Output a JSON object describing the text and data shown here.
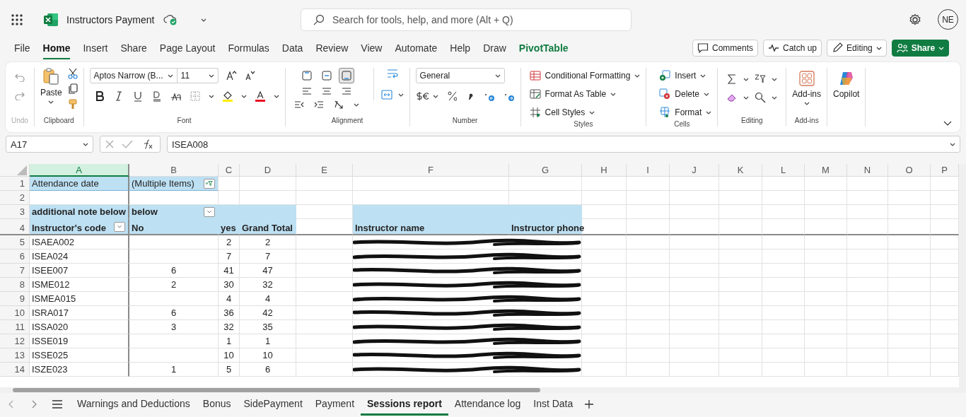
{
  "app": {
    "file_name": "Instructors Payment",
    "search_placeholder": "Search for tools, help, and more (Alt + Q)",
    "account_initials": "NE"
  },
  "menu_tabs": [
    {
      "label": "File",
      "selected": false,
      "kind": "plain"
    },
    {
      "label": "Home",
      "selected": true,
      "kind": "plain"
    },
    {
      "label": "Insert",
      "selected": false,
      "kind": "plain"
    },
    {
      "label": "Share",
      "selected": false,
      "kind": "plain"
    },
    {
      "label": "Page Layout",
      "selected": false,
      "kind": "plain"
    },
    {
      "label": "Formulas",
      "selected": false,
      "kind": "plain"
    },
    {
      "label": "Data",
      "selected": false,
      "kind": "plain"
    },
    {
      "label": "Review",
      "selected": false,
      "kind": "plain"
    },
    {
      "label": "View",
      "selected": false,
      "kind": "plain"
    },
    {
      "label": "Automate",
      "selected": false,
      "kind": "plain"
    },
    {
      "label": "Help",
      "selected": false,
      "kind": "plain"
    },
    {
      "label": "Draw",
      "selected": false,
      "kind": "plain"
    },
    {
      "label": "PivotTable",
      "selected": false,
      "kind": "contextual"
    }
  ],
  "actions": [
    {
      "label": "Comments",
      "kind": "comments"
    },
    {
      "label": "Catch up",
      "kind": "catchup"
    },
    {
      "label": "Editing",
      "kind": "editing"
    },
    {
      "label": "Share",
      "kind": "share"
    }
  ],
  "ribbon": {
    "undo": {
      "label": "Undo",
      "disabled": true
    },
    "clipboard": {
      "label": "Clipboard",
      "paste": "Paste"
    },
    "font": {
      "label": "Font",
      "font_name": "Aptos Narrow (B...",
      "font_size": "11"
    },
    "alignment": {
      "label": "Alignment",
      "vertical_align": [
        {
          "selected": false
        },
        {
          "selected": false
        },
        {
          "selected": true
        }
      ]
    },
    "number": {
      "label": "Number",
      "format": "General"
    },
    "styles": {
      "label": "Styles",
      "commands": [
        "Conditional Formatting",
        "Format As Table",
        "Cell Styles"
      ]
    },
    "cells": {
      "label": "Cells",
      "commands": [
        "Insert",
        "Delete",
        "Format"
      ]
    },
    "editing": {
      "label": "Editing"
    },
    "addins": {
      "label": "Add-ins",
      "button": "Add-ins"
    },
    "copilot": {
      "button": "Copilot"
    }
  },
  "formula_bar": {
    "name_box": "A17",
    "formula": "ISEA008"
  },
  "sheet": {
    "columns": [
      {
        "label": "A",
        "selected": true
      },
      {
        "label": "B",
        "selected": false
      },
      {
        "label": "C",
        "selected": false
      },
      {
        "label": "D",
        "selected": false
      },
      {
        "label": "E",
        "selected": false
      },
      {
        "label": "F",
        "selected": false
      },
      {
        "label": "G",
        "selected": false
      },
      {
        "label": "H",
        "selected": false
      },
      {
        "label": "I",
        "selected": false
      },
      {
        "label": "J",
        "selected": false
      },
      {
        "label": "K",
        "selected": false
      },
      {
        "label": "L",
        "selected": false
      },
      {
        "label": "M",
        "selected": false
      },
      {
        "label": "N",
        "selected": false
      },
      {
        "label": "O",
        "selected": false
      },
      {
        "label": "P",
        "selected": false
      }
    ],
    "rows": [
      {
        "number": "1",
        "redacted": false,
        "cells": [
          {
            "text": "Attendance date",
            "kind": "field"
          },
          {
            "text": "(Multiple Items)",
            "kind": "field",
            "filter_applied": true
          }
        ]
      },
      {
        "number": "2",
        "redacted": false
      },
      {
        "number": "3",
        "redacted": false,
        "cells": [
          {
            "text": "additional note below",
            "kind": "header"
          },
          {
            "text": "below",
            "kind": "header",
            "filter_applied": false
          },
          {
            "text": "",
            "kind": "header"
          },
          {
            "text": "",
            "kind": "header"
          },
          {
            "text": ""
          },
          {
            "text": "",
            "kind": "header"
          },
          {
            "text": "",
            "kind": "header"
          }
        ]
      },
      {
        "number": "4",
        "redacted": false,
        "cells": [
          {
            "text": "Instructor's code",
            "kind": "header",
            "filter_applied": false
          },
          {
            "text": "No",
            "kind": "header"
          },
          {
            "text": "yes",
            "kind": "header"
          },
          {
            "text": "Grand Total",
            "kind": "header"
          },
          {
            "text": ""
          },
          {
            "text": "Instructor name",
            "kind": "header"
          },
          {
            "text": "Instructor phone",
            "kind": "header"
          }
        ]
      },
      {
        "number": "5",
        "redacted": true,
        "cells": [
          {
            "text": "ISAEA002"
          },
          {
            "text": "",
            "kind": "number"
          },
          {
            "text": "2",
            "kind": "number"
          },
          {
            "text": "2",
            "kind": "number"
          }
        ]
      },
      {
        "number": "6",
        "redacted": true,
        "cells": [
          {
            "text": "ISEA024"
          },
          {
            "text": "",
            "kind": "number"
          },
          {
            "text": "7",
            "kind": "number"
          },
          {
            "text": "7",
            "kind": "number"
          }
        ]
      },
      {
        "number": "7",
        "redacted": true,
        "cells": [
          {
            "text": "ISEE007"
          },
          {
            "text": "6",
            "kind": "number"
          },
          {
            "text": "41",
            "kind": "number"
          },
          {
            "text": "47",
            "kind": "number"
          }
        ]
      },
      {
        "number": "8",
        "redacted": true,
        "cells": [
          {
            "text": "ISME012"
          },
          {
            "text": "2",
            "kind": "number"
          },
          {
            "text": "30",
            "kind": "number"
          },
          {
            "text": "32",
            "kind": "number"
          }
        ]
      },
      {
        "number": "9",
        "redacted": true,
        "cells": [
          {
            "text": "ISMEA015"
          },
          {
            "text": "",
            "kind": "number"
          },
          {
            "text": "4",
            "kind": "number"
          },
          {
            "text": "4",
            "kind": "number"
          }
        ]
      },
      {
        "number": "10",
        "redacted": true,
        "cells": [
          {
            "text": "ISRA017"
          },
          {
            "text": "6",
            "kind": "number"
          },
          {
            "text": "36",
            "kind": "number"
          },
          {
            "text": "42",
            "kind": "number"
          }
        ]
      },
      {
        "number": "11",
        "redacted": true,
        "cells": [
          {
            "text": "ISSA020"
          },
          {
            "text": "3",
            "kind": "number"
          },
          {
            "text": "32",
            "kind": "number"
          },
          {
            "text": "35",
            "kind": "number"
          }
        ]
      },
      {
        "number": "12",
        "redacted": true,
        "cells": [
          {
            "text": "ISSE019"
          },
          {
            "text": "",
            "kind": "number"
          },
          {
            "text": "1",
            "kind": "number"
          },
          {
            "text": "1",
            "kind": "number"
          }
        ]
      },
      {
        "number": "13",
        "redacted": true,
        "cells": [
          {
            "text": "ISSE025"
          },
          {
            "text": "",
            "kind": "number"
          },
          {
            "text": "10",
            "kind": "number"
          },
          {
            "text": "10",
            "kind": "number"
          }
        ]
      },
      {
        "number": "14",
        "redacted": true,
        "cells": [
          {
            "text": "ISZE023"
          },
          {
            "text": "1",
            "kind": "number"
          },
          {
            "text": "5",
            "kind": "number"
          },
          {
            "text": "6",
            "kind": "number"
          }
        ]
      }
    ]
  },
  "sheet_tabs": [
    {
      "label": "Warnings and Deductions",
      "selected": false
    },
    {
      "label": "Bonus",
      "selected": false
    },
    {
      "label": "SidePayment",
      "selected": false
    },
    {
      "label": "Payment",
      "selected": false
    },
    {
      "label": "Sessions report",
      "selected": true
    },
    {
      "label": "Attendance log",
      "selected": false
    },
    {
      "label": "Inst Data",
      "selected": false
    }
  ]
}
